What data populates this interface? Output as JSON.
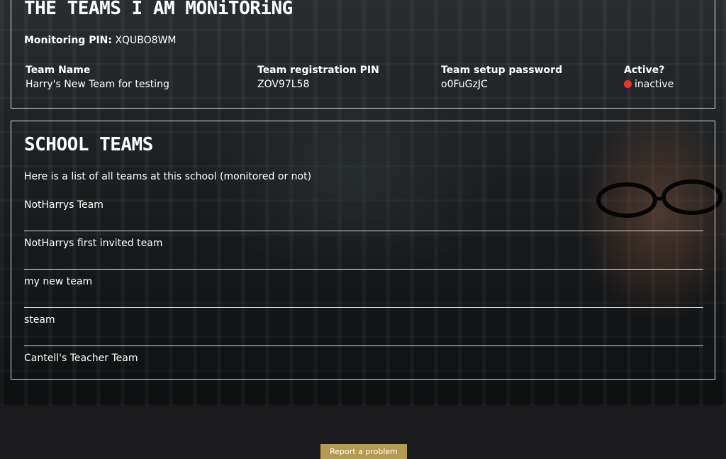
{
  "monitoring": {
    "heading": "THE TEAMS I AM MONiTORiNG",
    "pin_label": "Monitoring PIN:",
    "pin_value": "XQUBO8WM",
    "columns": [
      "Team Name",
      "Team registration PIN",
      "Team setup password",
      "Active?"
    ],
    "row": {
      "team_name": "Harry's New Team for testing",
      "registration_pin": "ZOV97L58",
      "setup_password": "o0FuGzJC",
      "active": "inactive",
      "active_color": "#e8372c"
    }
  },
  "school": {
    "heading": "SCHOOL TEAMS",
    "intro": "Here is a list of all teams at this school (monitored or not)",
    "teams": [
      "NotHarrys Team",
      "NotHarrys first invited team",
      "my new team",
      "steam",
      "Cantell's Teacher Team"
    ]
  },
  "footer": {
    "report_label": "Report a problem",
    "report_color": "#b49a52"
  }
}
